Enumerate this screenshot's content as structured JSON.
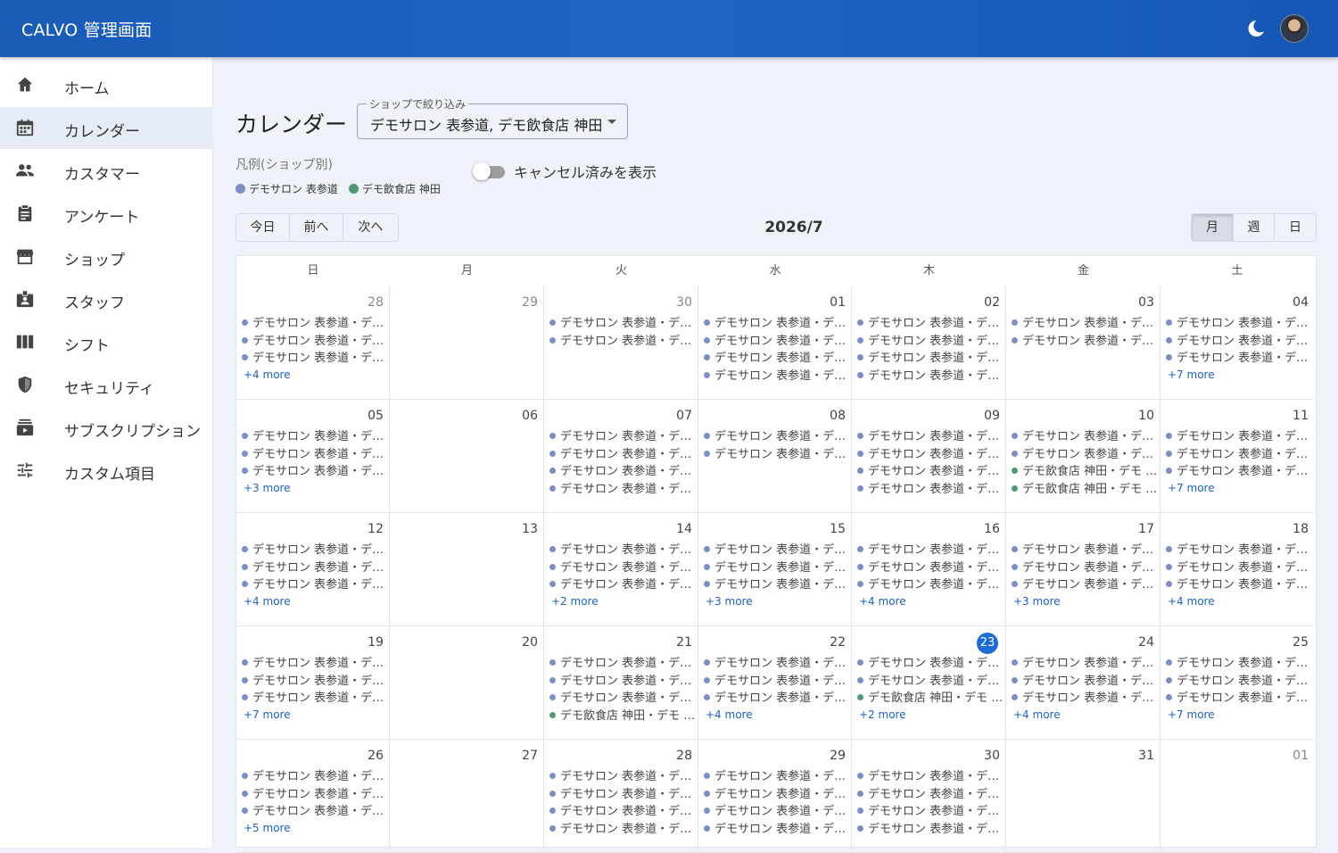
{
  "app": {
    "title": "CALVO 管理画面"
  },
  "colors": {
    "salon": "#7b8fc4",
    "restaurant": "#4e9a6e",
    "header": "#1a5bb8",
    "today": "#1d6bd6"
  },
  "sidebar": {
    "items": [
      {
        "label": "ホーム",
        "icon": "home-icon"
      },
      {
        "label": "カレンダー",
        "icon": "calendar-icon",
        "active": true
      },
      {
        "label": "カスタマー",
        "icon": "people-icon"
      },
      {
        "label": "アンケート",
        "icon": "clipboard-icon"
      },
      {
        "label": "ショップ",
        "icon": "store-icon"
      },
      {
        "label": "スタッフ",
        "icon": "badge-icon"
      },
      {
        "label": "シフト",
        "icon": "columns-icon"
      },
      {
        "label": "セキュリティ",
        "icon": "shield-icon"
      },
      {
        "label": "サブスクリプション",
        "icon": "subscription-icon"
      },
      {
        "label": "カスタム項目",
        "icon": "tune-icon"
      }
    ]
  },
  "page": {
    "title": "カレンダー"
  },
  "filter": {
    "legend": "ショップで絞り込み",
    "value": "デモサロン 表参道, デモ飲食店 神田"
  },
  "legend": {
    "title": "凡例(ショップ別)",
    "items": [
      {
        "label": "デモサロン 表参道"
      },
      {
        "label": "デモ飲食店 神田"
      }
    ]
  },
  "toggle": {
    "label": "キャンセル済みを表示",
    "checked": false
  },
  "nav_buttons": [
    "今日",
    "前へ",
    "次へ"
  ],
  "view_buttons": [
    "月",
    "週",
    "日"
  ],
  "selected_view": "月",
  "calendar": {
    "title": "2026/7",
    "weekdays": [
      "日",
      "月",
      "火",
      "水",
      "木",
      "金",
      "土"
    ],
    "weeks": [
      [
        {
          "day": "28",
          "other": true,
          "events": [
            [
              "デモサロン 表参道・デモ 五…",
              "s"
            ],
            [
              "デモサロン 表参道・デモ 三…",
              "s"
            ],
            [
              "デモサロン 表参道・デモ 六…",
              "s"
            ]
          ],
          "more": "+4 more"
        },
        {
          "day": "29",
          "other": true,
          "events": []
        },
        {
          "day": "30",
          "other": true,
          "events": [
            [
              "デモサロン 表参道・デモ 八…",
              "s"
            ],
            [
              "デモサロン 表参道・デモ 九…",
              "s"
            ]
          ]
        },
        {
          "day": "01",
          "events": [
            [
              "デモサロン 表参道・デモ 次…",
              "s"
            ],
            [
              "デモサロン 表参道・デモ 太…",
              "s"
            ],
            [
              "デモサロン 表参道・デモ 三…",
              "s"
            ],
            [
              "デモサロン 表参道・デモ 花…",
              "s"
            ]
          ]
        },
        {
          "day": "02",
          "events": [
            [
              "デモサロン 表参道・デモ 四…",
              "s"
            ],
            [
              "デモサロン 表参道・デモ 六…",
              "s"
            ],
            [
              "デモサロン 表参道・デモ 五…",
              "s"
            ],
            [
              "デモサロン 表参道・デモ 七…",
              "s"
            ]
          ]
        },
        {
          "day": "03",
          "events": [
            [
              "デモサロン 表参道・デモ 十…",
              "s"
            ],
            [
              "デモサロン 表参道・デモ 十…",
              "s"
            ]
          ]
        },
        {
          "day": "04",
          "events": [
            [
              "デモサロン 表参道・デモ 三…",
              "s"
            ],
            [
              "デモサロン 表参道・デモ 太…",
              "s"
            ],
            [
              "デモサロン 表参道・デモ 四…",
              "s"
            ]
          ],
          "more": "+7 more"
        }
      ],
      [
        {
          "day": "05",
          "events": [
            [
              "デモサロン 表参道・デモ 九…",
              "s"
            ],
            [
              "デモサロン 表参道・デモ 十…",
              "s"
            ],
            [
              "デモサロン 表参道・デモ 八…",
              "s"
            ]
          ],
          "more": "+3 more"
        },
        {
          "day": "06",
          "events": []
        },
        {
          "day": "07",
          "events": [
            [
              "デモサロン 表参道・デモ 太…",
              "s"
            ],
            [
              "デモサロン 表参道・デモ 次…",
              "s"
            ],
            [
              "デモサロン 表参道・デモ 花…",
              "s"
            ],
            [
              "デモサロン 表参道・デモ 三…",
              "s"
            ]
          ]
        },
        {
          "day": "08",
          "events": [
            [
              "デモサロン 表参道・デモ 六…",
              "s"
            ],
            [
              "デモサロン 表参道・デモ 七…",
              "s"
            ]
          ]
        },
        {
          "day": "09",
          "events": [
            [
              "デモサロン 表参道・デモ 十…",
              "s"
            ],
            [
              "デモサロン 表参道・デモ 八…",
              "s"
            ],
            [
              "デモサロン 表参道・デモ 十…",
              "s"
            ],
            [
              "デモサロン 表参道・デモ 九…",
              "s"
            ]
          ]
        },
        {
          "day": "10",
          "events": [
            [
              "デモサロン 表参道・デモ 太…",
              "s"
            ],
            [
              "デモサロン 表参道・デモ 花…",
              "s"
            ],
            [
              "デモ飲食店 神田・デモ 十郎…",
              "r"
            ],
            [
              "デモ飲食店 神田・デモ 十一…",
              "r"
            ]
          ]
        },
        {
          "day": "11",
          "events": [
            [
              "デモサロン 表参道・デモ 四…",
              "s"
            ],
            [
              "デモサロン 表参道・デモ 七…",
              "s"
            ],
            [
              "デモサロン 表参道・デモ 五…",
              "s"
            ]
          ],
          "more": "+7 more"
        }
      ],
      [
        {
          "day": "12",
          "events": [
            [
              "デモサロン 表参道・デモ 十…",
              "s"
            ],
            [
              "デモサロン 表参道・デモ 十…",
              "s"
            ],
            [
              "デモサロン 表参道・デモ 次…",
              "s"
            ]
          ],
          "more": "+4 more"
        },
        {
          "day": "13",
          "events": []
        },
        {
          "day": "14",
          "events": [
            [
              "デモサロン 表参道・デモ 五…",
              "s"
            ],
            [
              "デモサロン 表参道・デモ 三…",
              "s"
            ],
            [
              "デモサロン 表参道・デモ 六…",
              "s"
            ]
          ],
          "more": "+2 more"
        },
        {
          "day": "15",
          "events": [
            [
              "デモサロン 表参道・デモ 七…",
              "s"
            ],
            [
              "デモサロン 表参道・デモ 九…",
              "s"
            ],
            [
              "デモサロン 表参道・デモ 八…",
              "s"
            ]
          ],
          "more": "+3 more"
        },
        {
          "day": "16",
          "events": [
            [
              "デモサロン 表参道・デモ 花…",
              "s"
            ],
            [
              "デモサロン 表参道・デモ 十…",
              "s"
            ],
            [
              "デモサロン 表参道・デモ 次…",
              "s"
            ]
          ],
          "more": "+4 more"
        },
        {
          "day": "17",
          "events": [
            [
              "デモサロン 表参道・デモ 三…",
              "s"
            ],
            [
              "デモサロン 表参道・デモ 五…",
              "s"
            ],
            [
              "デモサロン 表参道・デモ 四…",
              "s"
            ]
          ],
          "more": "+3 more"
        },
        {
          "day": "18",
          "events": [
            [
              "デモサロン 表参道・デモ 七…",
              "s"
            ],
            [
              "デモサロン 表参道・デモ 十…",
              "s"
            ],
            [
              "デモサロン 表参道・デモ 十…",
              "s"
            ]
          ],
          "more": "+4 more"
        }
      ],
      [
        {
          "day": "19",
          "events": [
            [
              "デモサロン 表参道・デモ 三…",
              "s"
            ],
            [
              "デモサロン 表参道・デモ 太…",
              "s"
            ],
            [
              "デモサロン 表参道・デモ 四…",
              "s"
            ]
          ],
          "more": "+7 more"
        },
        {
          "day": "20",
          "events": []
        },
        {
          "day": "21",
          "events": [
            [
              "デモサロン 表参道・デモ 八…",
              "s"
            ],
            [
              "デモサロン 表参道・デモ 六…",
              "s"
            ],
            [
              "デモサロン 表参道・デモ 九…",
              "s"
            ],
            [
              "デモ飲食店 神田・デモ 五子 …",
              "r"
            ]
          ]
        },
        {
          "day": "22",
          "events": [
            [
              "デモサロン 表参道・デモ 十…",
              "s"
            ],
            [
              "デモサロン 表参道・デモ 太…",
              "s"
            ],
            [
              "デモサロン 表参道・デモ 十…",
              "s"
            ]
          ],
          "more": "+4 more"
        },
        {
          "day": "23",
          "today": true,
          "events": [
            [
              "デモサロン 表参道・デモ 次…",
              "s"
            ],
            [
              "デモサロン 表参道・デモ 三…",
              "s"
            ],
            [
              "デモ飲食店 神田・デモ 十一…",
              "r"
            ]
          ],
          "more": "+2 more"
        },
        {
          "day": "24",
          "events": [
            [
              "デモサロン 表参道・デモ 花…",
              "s"
            ],
            [
              "デモサロン 表参道・デモ 八…",
              "s"
            ],
            [
              "デモサロン 表参道・デモ 六…",
              "s"
            ]
          ],
          "more": "+4 more"
        },
        {
          "day": "25",
          "events": [
            [
              "デモサロン 表参道・デモ 花…",
              "s"
            ],
            [
              "デモサロン 表参道・デモ 十…",
              "s"
            ],
            [
              "デモサロン 表参道・デモ 次…",
              "s"
            ]
          ],
          "more": "+7 more"
        }
      ],
      [
        {
          "day": "26",
          "events": [
            [
              "デモサロン 表参道・デモ 四…",
              "s"
            ],
            [
              "デモサロン 表参道・デモ 七…",
              "s"
            ],
            [
              "デモサロン 表参道・デモ 五…",
              "s"
            ]
          ],
          "more": "+5 more"
        },
        {
          "day": "27",
          "events": []
        },
        {
          "day": "28",
          "events": [
            [
              "デモサロン 表参道・デモ 十…",
              "s"
            ],
            [
              "デモサロン 表参道・デモ 太…",
              "s"
            ],
            [
              "デモサロン 表参道・デモ 十…",
              "s"
            ],
            [
              "デモサロン 表参道・デモ 花…",
              "s"
            ]
          ]
        },
        {
          "day": "29",
          "events": [
            [
              "デモサロン 表参道・デモ 四…",
              "s"
            ],
            [
              "デモサロン 表参道・デモ 次…",
              "s"
            ],
            [
              "デモサロン 表参道・デモ 五…",
              "s"
            ],
            [
              "デモサロン 表参道・デモ 三…",
              "s"
            ]
          ]
        },
        {
          "day": "30",
          "events": [
            [
              "デモサロン 表参道・デモ 六…",
              "s"
            ],
            [
              "デモサロン 表参道・デモ 八…",
              "s"
            ],
            [
              "デモサロン 表参道・デモ 七…",
              "s"
            ],
            [
              "デモサロン 表参道・デモ 九…",
              "s"
            ]
          ]
        },
        {
          "day": "31",
          "events": []
        },
        {
          "day": "01",
          "other": true,
          "events": []
        }
      ]
    ]
  }
}
